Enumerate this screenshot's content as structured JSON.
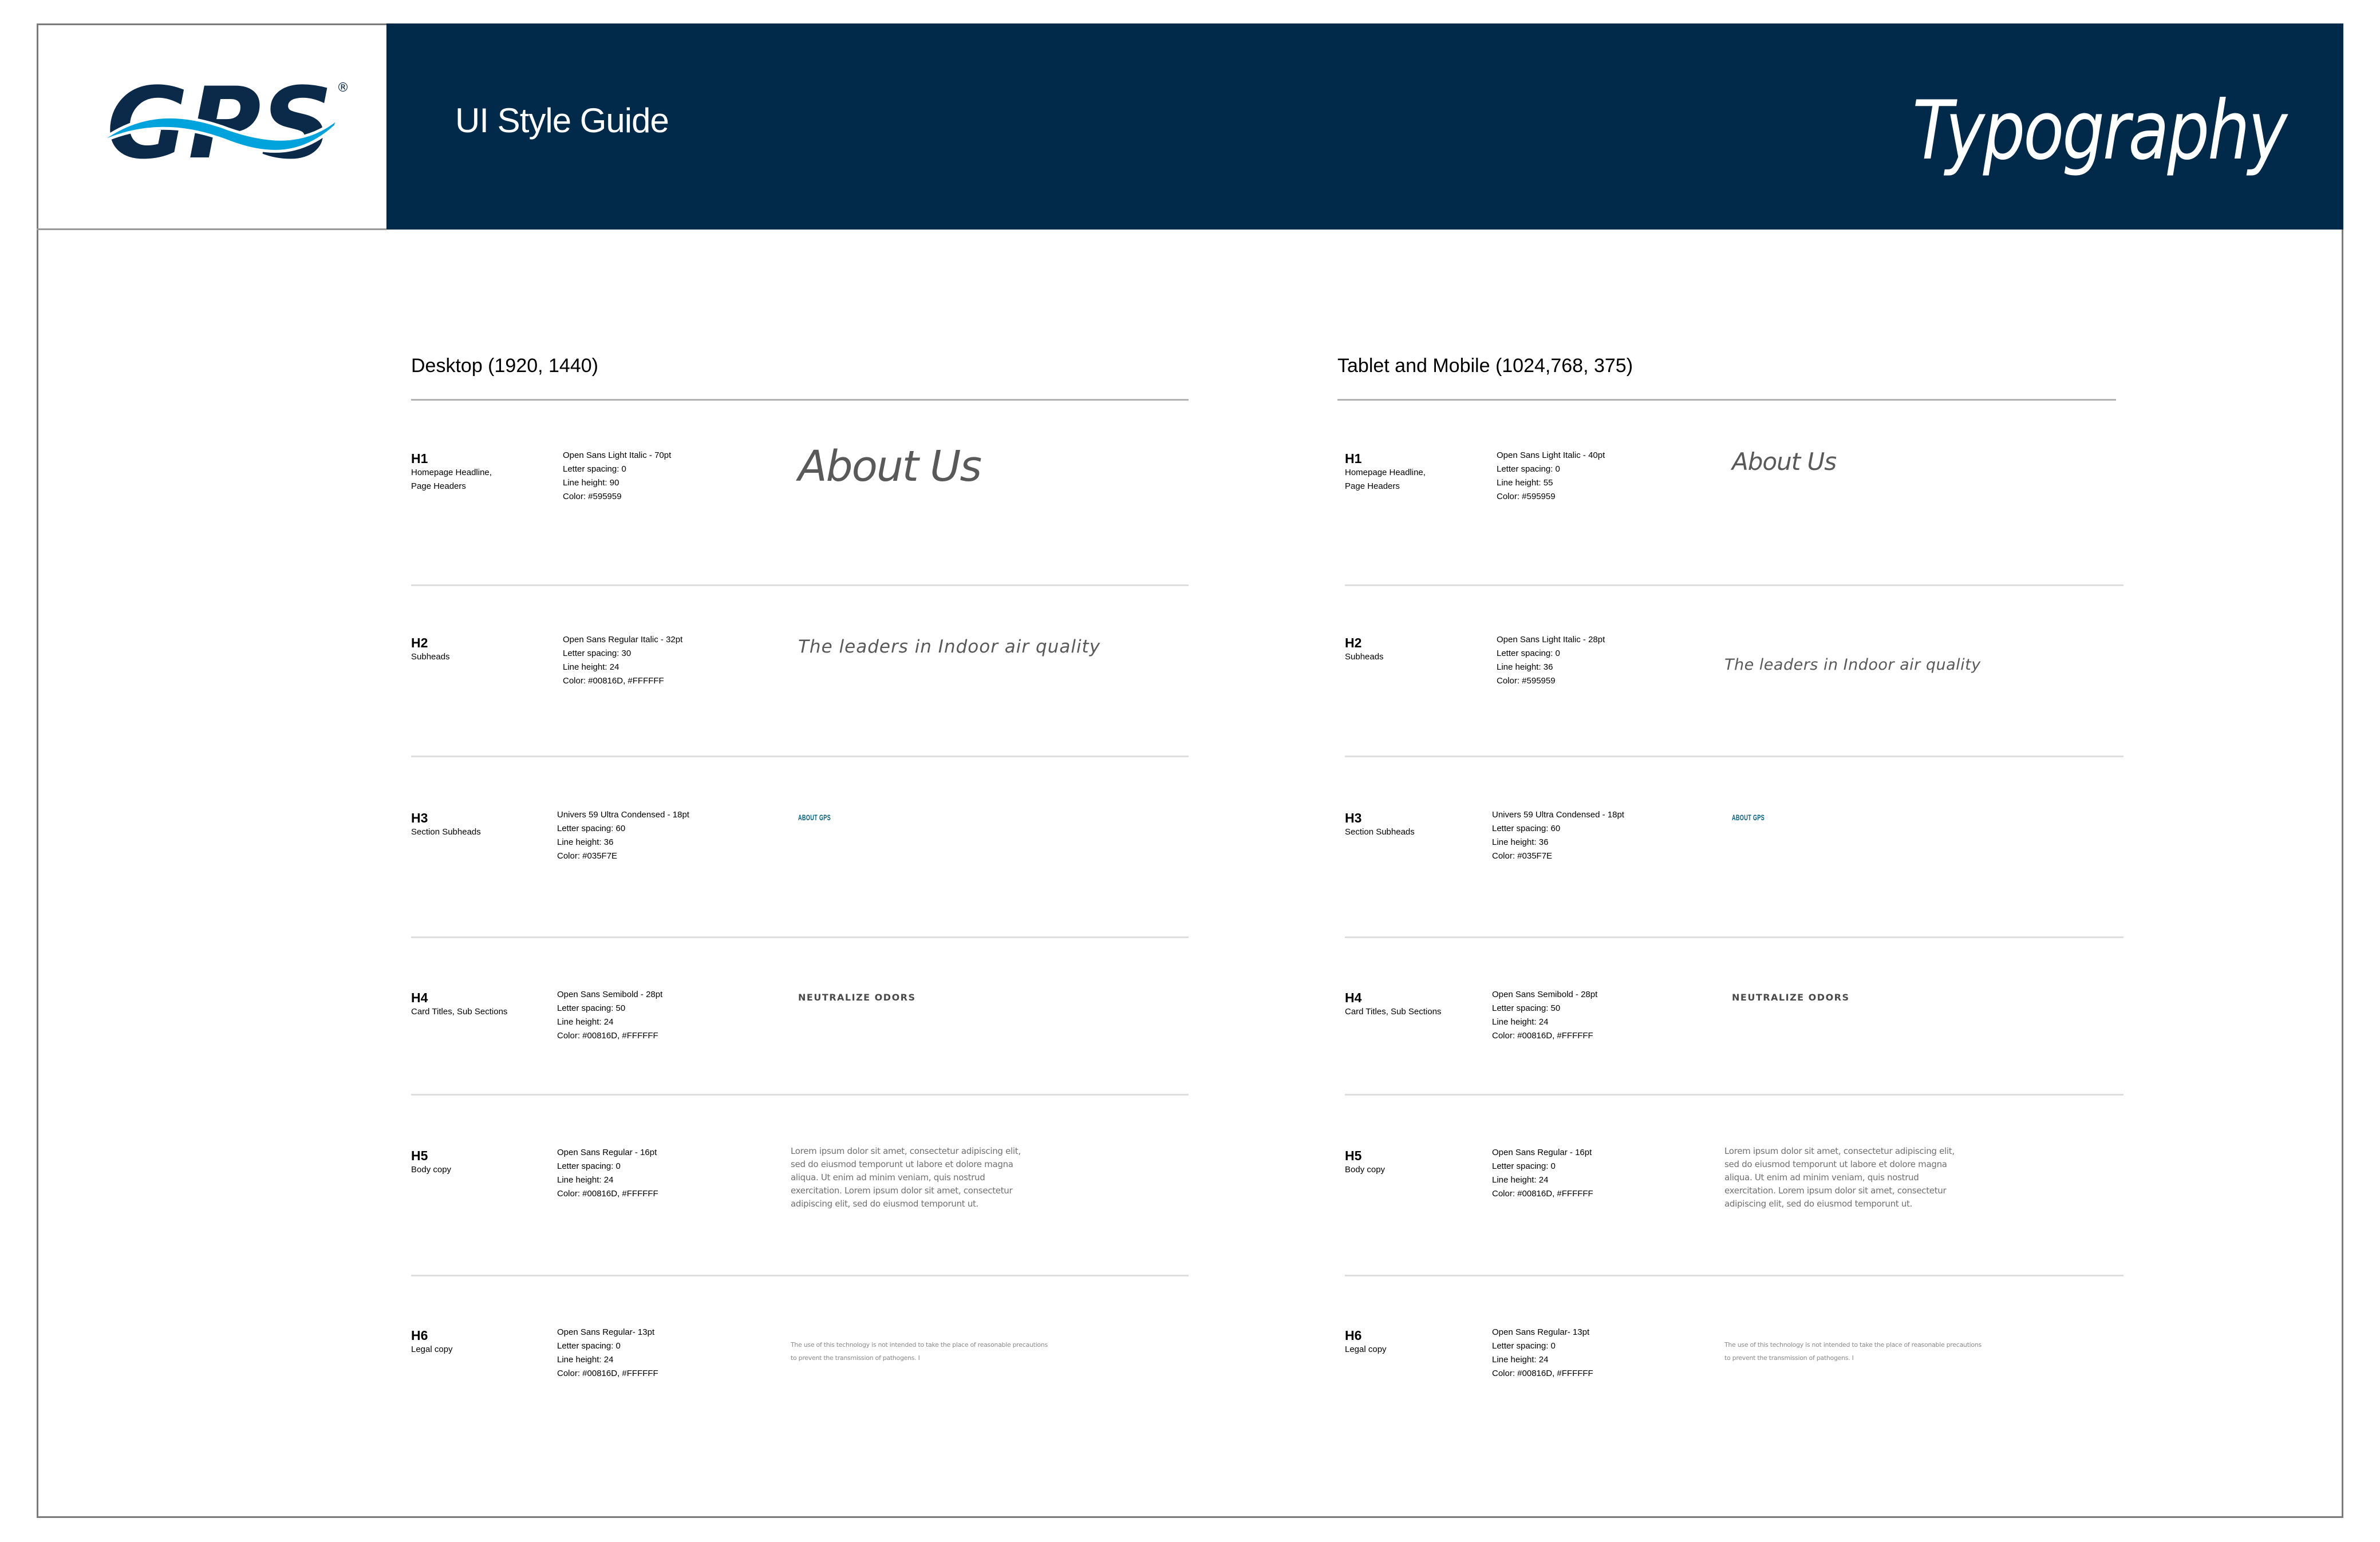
{
  "header": {
    "brand": "GPS",
    "registered_mark": "®",
    "title": "UI Style Guide",
    "section": "Typography",
    "colors": {
      "band": "#012A4A",
      "logo_dark": "#0B2A4A",
      "logo_wave": "#00A3DC"
    }
  },
  "columns": [
    {
      "heading": "Desktop (1920, 1440)",
      "rows": [
        {
          "level": "H1",
          "usage": [
            "Homepage Headline,",
            "Page Headers"
          ],
          "spec": [
            "Open Sans Light Italic - 70pt",
            "Letter spacing: 0",
            "Line height: 90",
            "Color: #595959"
          ],
          "sample": "About Us"
        },
        {
          "level": "H2",
          "usage": [
            "Subheads"
          ],
          "spec": [
            "Open Sans Regular Italic - 32pt",
            "Letter spacing: 30",
            "Line height: 24",
            "Color: #00816D, #FFFFFF"
          ],
          "sample": "The leaders in Indoor air quality"
        },
        {
          "level": "H3",
          "usage": [
            "Section Subheads"
          ],
          "spec": [
            "Univers 59 Ultra Condensed - 18pt",
            "Letter spacing: 60",
            "Line height: 36",
            "Color: #035F7E"
          ],
          "sample": "ABOUT GPS"
        },
        {
          "level": "H4",
          "usage": [
            "Card Titles, Sub Sections"
          ],
          "spec": [
            "Open Sans Semibold - 28pt",
            "Letter spacing: 50",
            "Line height: 24",
            "Color: #00816D, #FFFFFF"
          ],
          "sample": "NEUTRALIZE ODORS"
        },
        {
          "level": "H5",
          "usage": [
            "Body copy"
          ],
          "spec": [
            "Open Sans Regular - 16pt",
            "Letter spacing: 0",
            "Line height: 24",
            "Color: #00816D, #FFFFFF"
          ],
          "sample": "Lorem ipsum dolor sit amet, consectetur adipiscing elit, sed do eiusmod temporunt ut labore et dolore magna aliqua. Ut enim ad minim veniam, quis nostrud exercitation. Lorem ipsum dolor sit amet, consectetur adipiscing elit, sed do eiusmod temporunt ut."
        },
        {
          "level": "H6",
          "usage": [
            "Legal copy"
          ],
          "spec": [
            "Open Sans Regular- 13pt",
            "Letter spacing: 0",
            "Line height: 24",
            "Color: #00816D, #FFFFFF"
          ],
          "sample": "The use of this technology is not intended to take the place of reasonable precautions to prevent the transmission of pathogens. I"
        }
      ]
    },
    {
      "heading": "Tablet and Mobile (1024,768, 375)",
      "rows": [
        {
          "level": "H1",
          "usage": [
            "Homepage Headline,",
            "Page Headers"
          ],
          "spec": [
            "Open Sans Light Italic - 40pt",
            "Letter spacing: 0",
            "Line height: 55",
            "Color: #595959"
          ],
          "sample": "About Us"
        },
        {
          "level": "H2",
          "usage": [
            "Subheads"
          ],
          "spec": [
            "Open Sans Light Italic - 28pt",
            "Letter spacing: 0",
            "Line height: 36",
            "Color: #595959"
          ],
          "sample": "The leaders in Indoor air quality"
        },
        {
          "level": "H3",
          "usage": [
            "Section Subheads"
          ],
          "spec": [
            "Univers 59 Ultra Condensed - 18pt",
            "Letter spacing: 60",
            "Line height: 36",
            "Color: #035F7E"
          ],
          "sample": "ABOUT GPS"
        },
        {
          "level": "H4",
          "usage": [
            "Card Titles, Sub Sections"
          ],
          "spec": [
            "Open Sans Semibold - 28pt",
            "Letter spacing: 50",
            "Line height: 24",
            "Color: #00816D, #FFFFFF"
          ],
          "sample": "NEUTRALIZE ODORS"
        },
        {
          "level": "H5",
          "usage": [
            "Body copy"
          ],
          "spec": [
            "Open Sans Regular - 16pt",
            "Letter spacing: 0",
            "Line height: 24",
            "Color: #00816D, #FFFFFF"
          ],
          "sample": "Lorem ipsum dolor sit amet, consectetur adipiscing elit, sed do eiusmod temporunt ut labore et dolore magna aliqua. Ut enim ad minim veniam, quis nostrud exercitation. Lorem ipsum dolor sit amet, consectetur adipiscing elit, sed do eiusmod temporunt ut."
        },
        {
          "level": "H6",
          "usage": [
            "Legal copy"
          ],
          "spec": [
            "Open Sans Regular- 13pt",
            "Letter spacing: 0",
            "Line height: 24",
            "Color: #00816D, #FFFFFF"
          ],
          "sample": "The use of this technology is not intended to take the place of reasonable precautions to prevent the transmission of pathogens. I"
        }
      ]
    }
  ]
}
